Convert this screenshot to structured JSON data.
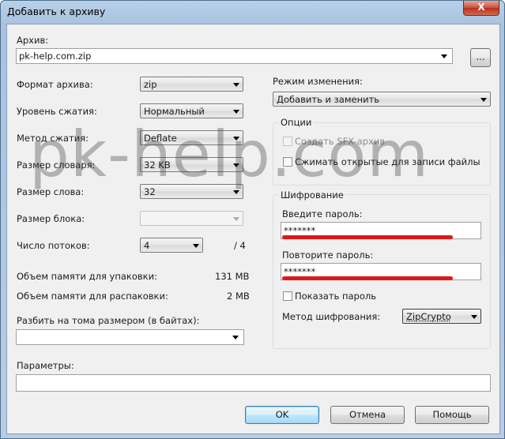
{
  "window": {
    "title": "Добавить к архиву",
    "close_glyph": "X"
  },
  "archive": {
    "label": "Архив:",
    "value": "pk-help.com.zip",
    "browse_label": "..."
  },
  "left": {
    "format": {
      "label": "Формат архива:",
      "value": "zip"
    },
    "level": {
      "label": "Уровень сжатия:",
      "value": "Нормальный"
    },
    "method": {
      "label": "Метод сжатия:",
      "value": "Deflate"
    },
    "dict": {
      "label": "Размер словаря:",
      "value": "32 KB"
    },
    "word": {
      "label": "Размер слова:",
      "value": "32"
    },
    "block": {
      "label": "Размер блока:",
      "value": ""
    },
    "threads": {
      "label": "Число потоков:",
      "value": "4",
      "max": "/ 4"
    },
    "mem_pack": {
      "label": "Объем памяти для упаковки:",
      "value": "131 MB"
    },
    "mem_unpack": {
      "label": "Объем памяти для распаковки:",
      "value": "2 MB"
    },
    "split": {
      "label": "Разбить на тома размером (в байтах):",
      "value": ""
    }
  },
  "right": {
    "mode": {
      "label": "Режим изменения:",
      "value": "Добавить и заменить"
    },
    "options": {
      "title": "Опции",
      "sfx": "Создать SFX-архив",
      "shared": "Сжимать открытые для записи файлы"
    },
    "encryption": {
      "title": "Шифрование",
      "password_label": "Введите пароль:",
      "password_value": "*******",
      "repeat_label": "Повторите пароль:",
      "repeat_value": "*******",
      "show_password": "Показать пароль",
      "method_label": "Метод шифрования:",
      "method_value": "ZipCrypto"
    }
  },
  "params": {
    "label": "Параметры:",
    "value": ""
  },
  "buttons": {
    "ok": "OK",
    "cancel": "Отмена",
    "help": "Помощь"
  },
  "watermark": "pk-help.com"
}
